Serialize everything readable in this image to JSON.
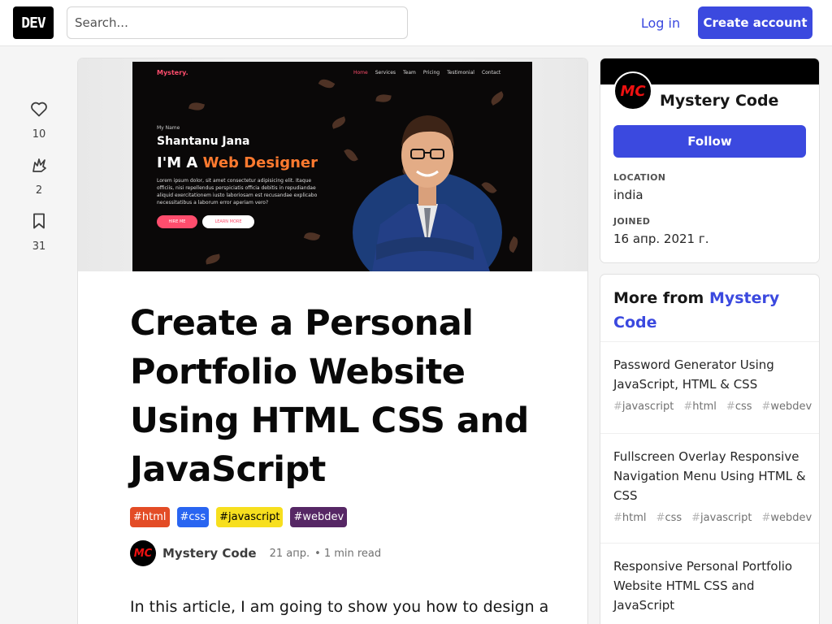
{
  "header": {
    "logo_text": "DEV",
    "search_placeholder": "Search...",
    "login_label": "Log in",
    "create_account_label": "Create account"
  },
  "reactions": {
    "likes": "10",
    "unicorns": "2",
    "bookmarks": "31"
  },
  "cover": {
    "brand": "Mystery.",
    "nav": [
      "Home",
      "Services",
      "Team",
      "Pricing",
      "Testimonial",
      "Contact"
    ],
    "my_name_label": "My Name",
    "person_name": "Shantanu Jana",
    "role_prefix": "I'M A",
    "role_highlight": "Web Designer",
    "lorem": "Lorem ipsum dolor, sit amet consectetur adipisicing elit. Itaque officiis, nisi repellendus perspiciatis officia debitis in repudiandae aliquid exercitationem iusto laboriosam est recusandae explicabo necessitatibus a laborum error aperiam vero?",
    "hire_label": "HIRE ME",
    "learn_label": "LEARN MORE"
  },
  "article": {
    "title": "Create a Personal Portfolio Website Using HTML CSS and JavaScript",
    "tags": [
      {
        "name": "#html",
        "bg": "#e34c26",
        "fg": "#ffffff"
      },
      {
        "name": "#css",
        "bg": "#2965f1",
        "fg": "#ffffff"
      },
      {
        "name": "#javascript",
        "bg": "#f7df1e",
        "fg": "#000000"
      },
      {
        "name": "#webdev",
        "bg": "#562765",
        "fg": "#ffffff"
      }
    ],
    "author": "Mystery Code",
    "avatar_initials": "MC",
    "date": "21 апр.",
    "read_time": "1 min read",
    "body_start": "In this article, I am going to show you how to design a"
  },
  "author_card": {
    "name": "Mystery Code",
    "avatar_initials": "MC",
    "follow_label": "Follow",
    "location_label": "LOCATION",
    "location_value": "india",
    "joined_label": "JOINED",
    "joined_value": "16 апр. 2021 г."
  },
  "more_from": {
    "prefix": "More from",
    "author": "Mystery Code",
    "items": [
      {
        "title": "Password Generator Using JavaScript, HTML & CSS",
        "tags": [
          "javascript",
          "html",
          "css",
          "webdev"
        ]
      },
      {
        "title": "Fullscreen Overlay Responsive Navigation Menu Using HTML & CSS",
        "tags": [
          "html",
          "css",
          "javascript",
          "webdev"
        ]
      },
      {
        "title": "Responsive Personal Portfolio Website HTML CSS and JavaScript",
        "tags": []
      }
    ]
  },
  "colors": {
    "accent": "#3b49df",
    "background": "#f5f5f5"
  }
}
